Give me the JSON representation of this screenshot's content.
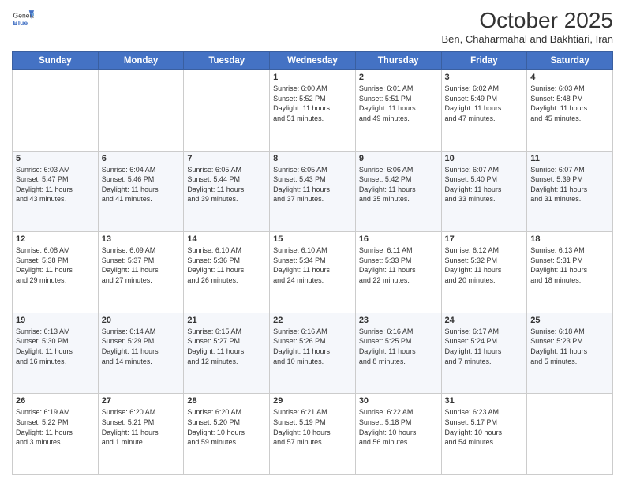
{
  "header": {
    "logo_general": "General",
    "logo_blue": "Blue",
    "month_title": "October 2025",
    "subtitle": "Ben, Chaharmahal and Bakhtiari, Iran"
  },
  "weekdays": [
    "Sunday",
    "Monday",
    "Tuesday",
    "Wednesday",
    "Thursday",
    "Friday",
    "Saturday"
  ],
  "weeks": [
    [
      {
        "day": "",
        "info": ""
      },
      {
        "day": "",
        "info": ""
      },
      {
        "day": "",
        "info": ""
      },
      {
        "day": "1",
        "info": "Sunrise: 6:00 AM\nSunset: 5:52 PM\nDaylight: 11 hours\nand 51 minutes."
      },
      {
        "day": "2",
        "info": "Sunrise: 6:01 AM\nSunset: 5:51 PM\nDaylight: 11 hours\nand 49 minutes."
      },
      {
        "day": "3",
        "info": "Sunrise: 6:02 AM\nSunset: 5:49 PM\nDaylight: 11 hours\nand 47 minutes."
      },
      {
        "day": "4",
        "info": "Sunrise: 6:03 AM\nSunset: 5:48 PM\nDaylight: 11 hours\nand 45 minutes."
      }
    ],
    [
      {
        "day": "5",
        "info": "Sunrise: 6:03 AM\nSunset: 5:47 PM\nDaylight: 11 hours\nand 43 minutes."
      },
      {
        "day": "6",
        "info": "Sunrise: 6:04 AM\nSunset: 5:46 PM\nDaylight: 11 hours\nand 41 minutes."
      },
      {
        "day": "7",
        "info": "Sunrise: 6:05 AM\nSunset: 5:44 PM\nDaylight: 11 hours\nand 39 minutes."
      },
      {
        "day": "8",
        "info": "Sunrise: 6:05 AM\nSunset: 5:43 PM\nDaylight: 11 hours\nand 37 minutes."
      },
      {
        "day": "9",
        "info": "Sunrise: 6:06 AM\nSunset: 5:42 PM\nDaylight: 11 hours\nand 35 minutes."
      },
      {
        "day": "10",
        "info": "Sunrise: 6:07 AM\nSunset: 5:40 PM\nDaylight: 11 hours\nand 33 minutes."
      },
      {
        "day": "11",
        "info": "Sunrise: 6:07 AM\nSunset: 5:39 PM\nDaylight: 11 hours\nand 31 minutes."
      }
    ],
    [
      {
        "day": "12",
        "info": "Sunrise: 6:08 AM\nSunset: 5:38 PM\nDaylight: 11 hours\nand 29 minutes."
      },
      {
        "day": "13",
        "info": "Sunrise: 6:09 AM\nSunset: 5:37 PM\nDaylight: 11 hours\nand 27 minutes."
      },
      {
        "day": "14",
        "info": "Sunrise: 6:10 AM\nSunset: 5:36 PM\nDaylight: 11 hours\nand 26 minutes."
      },
      {
        "day": "15",
        "info": "Sunrise: 6:10 AM\nSunset: 5:34 PM\nDaylight: 11 hours\nand 24 minutes."
      },
      {
        "day": "16",
        "info": "Sunrise: 6:11 AM\nSunset: 5:33 PM\nDaylight: 11 hours\nand 22 minutes."
      },
      {
        "day": "17",
        "info": "Sunrise: 6:12 AM\nSunset: 5:32 PM\nDaylight: 11 hours\nand 20 minutes."
      },
      {
        "day": "18",
        "info": "Sunrise: 6:13 AM\nSunset: 5:31 PM\nDaylight: 11 hours\nand 18 minutes."
      }
    ],
    [
      {
        "day": "19",
        "info": "Sunrise: 6:13 AM\nSunset: 5:30 PM\nDaylight: 11 hours\nand 16 minutes."
      },
      {
        "day": "20",
        "info": "Sunrise: 6:14 AM\nSunset: 5:29 PM\nDaylight: 11 hours\nand 14 minutes."
      },
      {
        "day": "21",
        "info": "Sunrise: 6:15 AM\nSunset: 5:27 PM\nDaylight: 11 hours\nand 12 minutes."
      },
      {
        "day": "22",
        "info": "Sunrise: 6:16 AM\nSunset: 5:26 PM\nDaylight: 11 hours\nand 10 minutes."
      },
      {
        "day": "23",
        "info": "Sunrise: 6:16 AM\nSunset: 5:25 PM\nDaylight: 11 hours\nand 8 minutes."
      },
      {
        "day": "24",
        "info": "Sunrise: 6:17 AM\nSunset: 5:24 PM\nDaylight: 11 hours\nand 7 minutes."
      },
      {
        "day": "25",
        "info": "Sunrise: 6:18 AM\nSunset: 5:23 PM\nDaylight: 11 hours\nand 5 minutes."
      }
    ],
    [
      {
        "day": "26",
        "info": "Sunrise: 6:19 AM\nSunset: 5:22 PM\nDaylight: 11 hours\nand 3 minutes."
      },
      {
        "day": "27",
        "info": "Sunrise: 6:20 AM\nSunset: 5:21 PM\nDaylight: 11 hours\nand 1 minute."
      },
      {
        "day": "28",
        "info": "Sunrise: 6:20 AM\nSunset: 5:20 PM\nDaylight: 10 hours\nand 59 minutes."
      },
      {
        "day": "29",
        "info": "Sunrise: 6:21 AM\nSunset: 5:19 PM\nDaylight: 10 hours\nand 57 minutes."
      },
      {
        "day": "30",
        "info": "Sunrise: 6:22 AM\nSunset: 5:18 PM\nDaylight: 10 hours\nand 56 minutes."
      },
      {
        "day": "31",
        "info": "Sunrise: 6:23 AM\nSunset: 5:17 PM\nDaylight: 10 hours\nand 54 minutes."
      },
      {
        "day": "",
        "info": ""
      }
    ]
  ]
}
